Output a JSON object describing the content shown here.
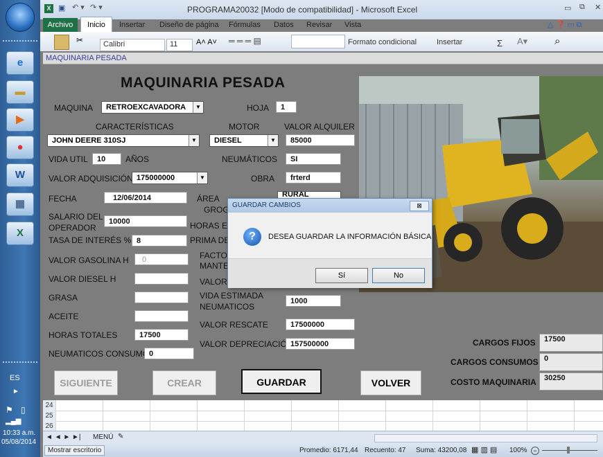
{
  "window": {
    "title": "PROGRAMA20032  [Modo de compatibilidad]  -  Microsoft Excel"
  },
  "ribbon": {
    "tabs": [
      "Archivo",
      "Inicio",
      "Insertar",
      "Diseño de página",
      "Fórmulas",
      "Datos",
      "Revisar",
      "Vista"
    ],
    "font_name": "Calibri",
    "font_size": "11",
    "conditional_format": "Formato condicional",
    "insert": "Insertar",
    "sum_symbol": "Σ"
  },
  "form": {
    "titlebar": "MAQUINARIA PESADA",
    "heading": "MAQUINARIA PESADA",
    "maquina_label": "MAQUINA",
    "maquina_value": "RETROEXCAVADORA",
    "hoja_label": "HOJA",
    "hoja_value": "1",
    "caracteristicas_label": "CARACTERÍSTICAS",
    "caracteristicas_value": "JOHN DEERE 310SJ",
    "motor_label": "MOTOR",
    "motor_value": "DIESEL",
    "alquiler_label": "VALOR ALQUILER",
    "alquiler_value": "85000",
    "vida_util_label": "VIDA UTIL",
    "vida_util_value": "10",
    "anios_label": "AÑOS",
    "neumaticos_label": "NEUMÁTICOS",
    "neumaticos_value": "SI",
    "adquisicion_label": "VALOR ADQUISICIÓN",
    "adquisicion_value": "175000000",
    "obra_label": "OBRA",
    "obra_value": "frterd",
    "fecha_label": "FECHA",
    "fecha_value": "12/06/2014",
    "area_label": "ÁREA",
    "area_value": "RURAL",
    "grog_label": "GROG",
    "salario_label": "SALARIO DEL",
    "salario_label2": "OPERADOR",
    "salario_value": "10000",
    "horas_es_label": "HORAS ES",
    "tasa_label": "TASA DE INTERÉS %",
    "tasa_value": "8",
    "prima_label": "PRIMA DE",
    "gasolina_label": "VALOR GASOLINA H",
    "gasolina_value": "0",
    "facto_label": "FACTO",
    "mante_label": "MANTE",
    "diesel_label": "VALOR DIESEL H",
    "valor_label": "VALOR",
    "grasa_label": "GRASA",
    "vida_estimada_label": "VIDA ESTIMADA",
    "vida_estimada_label2": "NEUMATICOS",
    "vida_estimada_value": "1000",
    "aceite_label": "ACEITE",
    "rescate_label": "VALOR RESCATE",
    "rescate_value": "17500000",
    "horas_totales_label": "HORAS TOTALES",
    "horas_totales_value": "17500",
    "depreciacion_label": "VALOR DEPRECIACIÓN",
    "depreciacion_value": "157500000",
    "neumaticos_consumo_label": "NEUMATICOS CONSUMO",
    "neumaticos_consumo_value": "0",
    "cargos_fijos_label": "CARGOS FIJOS",
    "cargos_fijos_value": "17500",
    "cargos_consumos_label": "CARGOS CONSUMOS",
    "cargos_consumos_value": "0",
    "costo_label": "COSTO MAQUINARIA",
    "costo_value": "30250",
    "btn_siguiente": "SIGUIENTE",
    "btn_crear": "CREAR LIBRO",
    "btn_guardar": "GUARDAR HOJA",
    "btn_volver": "VOLVER"
  },
  "dialog": {
    "title": "GUARDAR CAMBIOS",
    "close": "⊠",
    "message": "DESEA GUARDAR LA INFORMACIÓN BÁSICA",
    "yes": "Sí",
    "no": "No"
  },
  "sheet": {
    "rows": [
      "24",
      "25",
      "26"
    ],
    "sheet_tab": "MENÚ",
    "nav": "◄ ◄ ► ►|"
  },
  "status": {
    "left": "Mostrar escritorio",
    "promedio": "Promedio: 6171,44",
    "recuento": "Recuento: 47",
    "suma": "Suma: 43200,08",
    "zoom": "100%"
  },
  "tray": {
    "lang": "ES",
    "time": "10:33 a.m.",
    "date": "05/08/2014"
  }
}
